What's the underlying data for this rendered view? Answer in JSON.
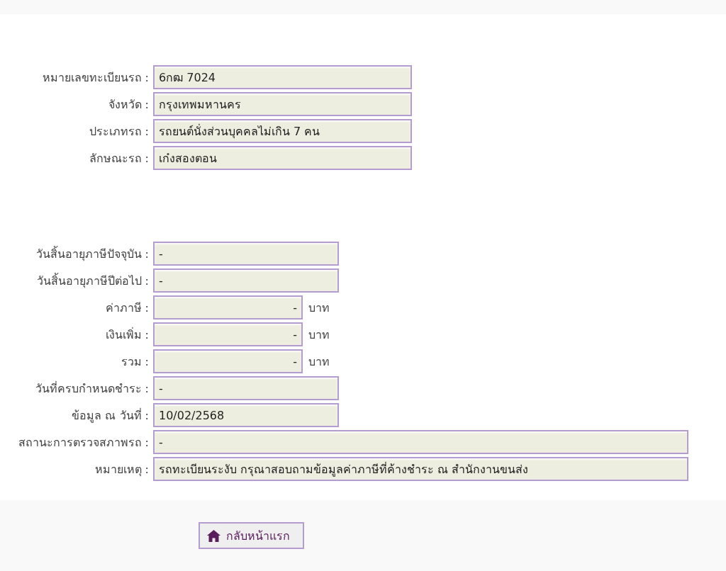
{
  "sections": [
    {
      "fields": [
        {
          "label": "หมายเลขทะเบียนรถ :",
          "value": "6กฒ 7024",
          "kind": "wide"
        },
        {
          "label": "จังหวัด :",
          "value": "กรุงเทพมหานคร",
          "kind": "wide"
        },
        {
          "label": "ประเภทรถ :",
          "value": "รถยนต์นั่งส่วนบุคคลไม่เกิน 7 คน",
          "kind": "wide"
        },
        {
          "label": "ลักษณะรถ :",
          "value": "เก๋งสองตอน",
          "kind": "wide"
        }
      ]
    },
    {
      "fields": [
        {
          "label": "วันสิ้นอายุภาษีปัจจุบัน :",
          "value": "-",
          "kind": "medium"
        },
        {
          "label": "วันสิ้นอายุภาษีปีต่อไป :",
          "value": "-",
          "kind": "medium"
        },
        {
          "label": "ค่าภาษี :",
          "value": "-",
          "kind": "amount",
          "unit": "บาท"
        },
        {
          "label": "เงินเพิ่ม :",
          "value": "-",
          "kind": "amount",
          "unit": "บาท"
        },
        {
          "label": "รวม :",
          "value": "-",
          "kind": "amount",
          "unit": "บาท"
        },
        {
          "label": "วันที่ครบกำหนดชำระ :",
          "value": "-",
          "kind": "medium"
        },
        {
          "label": "ข้อมูล ณ วันที่ :",
          "value": "10/02/2568",
          "kind": "medium"
        },
        {
          "label": "สถานะการตรวจสภาพรถ :",
          "value": "-",
          "kind": "full"
        },
        {
          "label": "หมายเหตุ :",
          "value": "รถทะเบียนระงับ กรุณาสอบถามข้อมูลค่าภาษีที่ค้างชำระ ณ สำนักงานขนส่ง",
          "kind": "full"
        }
      ]
    }
  ],
  "home_button": {
    "label": "กลับหน้าแรก"
  }
}
